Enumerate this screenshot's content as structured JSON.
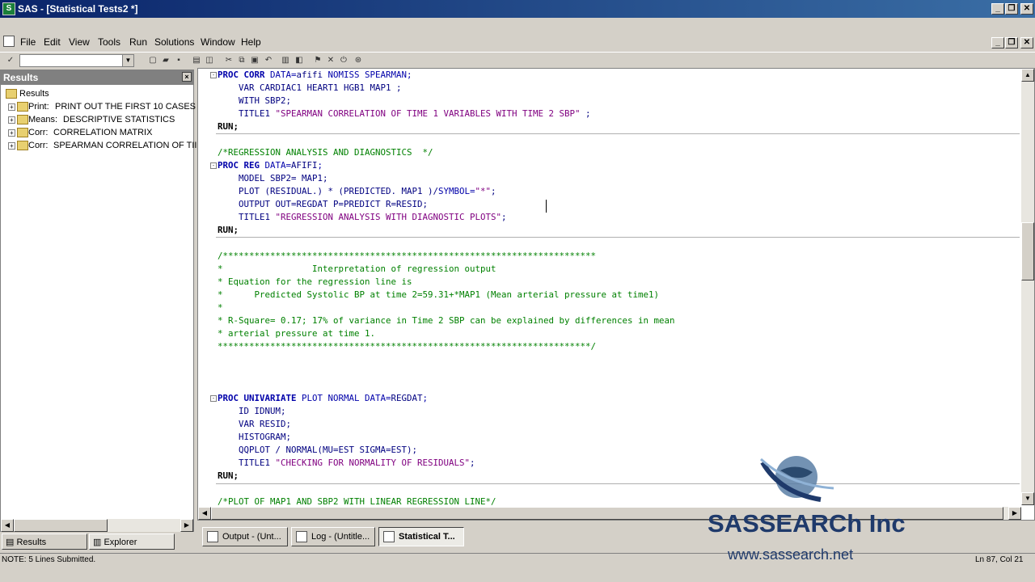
{
  "window": {
    "title": "SAS - [Statistical Tests2 *]",
    "minimize": "_",
    "restore": "❐",
    "close": "✕"
  },
  "menu": {
    "items": [
      "File",
      "Edit",
      "View",
      "Tools",
      "Run",
      "Solutions",
      "Window",
      "Help"
    ]
  },
  "toolbar": {
    "command_value": "",
    "check_glyph": "✓"
  },
  "results": {
    "title": "Results",
    "close": "×",
    "root": "Results",
    "items": [
      {
        "prefix": "Print:",
        "label": "PRINT OUT THE FIRST 10 CASES"
      },
      {
        "prefix": "Means:",
        "label": "DESCRIPTIVE STATISTICS"
      },
      {
        "prefix": "Corr:",
        "label": "CORRELATION MATRIX"
      },
      {
        "prefix": "Corr:",
        "label": "SPEARMAN CORRELATION OF TII"
      }
    ]
  },
  "left_tabs": {
    "results": "Results",
    "explorer": "Explorer"
  },
  "code": {
    "l1a": "PROC CORR",
    "l1b": " DATA=",
    "l1c": "afifi",
    "l1d": " NOMISS SPEARMAN;",
    "l2": "    VAR CARDIAC1 HEART1 HGB1 MAP1 ;",
    "l3": "    WITH SBP2;",
    "l4a": "    TITLE1 ",
    "l4b": "\"SPEARMAN CORRELATION OF TIME 1 VARIABLES WITH TIME 2 SBP\"",
    "l4c": " ;",
    "l5": "RUN;",
    "l6": "/*REGRESSION ANALYSIS AND DIAGNOSTICS  */",
    "l7a": "PROC REG",
    "l7b": " DATA=",
    "l7c": "AFIFI",
    "l7d": ";",
    "l8": "    MODEL SBP2= MAP1;",
    "l9a": "    PLOT (RESIDUAL.) * (PREDICTED. MAP1 )/",
    "l9b": "SYMBOL=",
    "l9c": "\"*\"",
    "l9d": ";",
    "l10a": "    OUTPUT OUT=REGDAT P=PREDICT R=RESID;",
    "l11a": "    TITLE1 ",
    "l11b": "\"REGRESSION ANALYSIS WITH DIAGNOSTIC PLOTS\"",
    "l11c": ";",
    "l12": "RUN;",
    "c1": "/***********************************************************************",
    "c2": "*                 Interpretation of regression output",
    "c3": "* Equation for the regression line is",
    "c4": "*      Predicted Systolic BP at time 2=59.31+*MAP1 (Mean arterial pressure at time1)",
    "c5": "*",
    "c6": "* R-Square= 0.17; 17% of variance in Time 2 SBP can be explained by differences in mean",
    "c7": "* arterial pressure at time 1.",
    "c8": "***********************************************************************/",
    "u1a": "PROC UNIVARIATE",
    "u1b": " PLOT NORMAL DATA=",
    "u1c": "REGDAT",
    "u1d": ";",
    "u2": "    ID IDNUM;",
    "u3": "    VAR RESID;",
    "u4": "    HISTOGRAM;",
    "u5": "    QQPLOT / NORMAL(MU=EST SIGMA=EST);",
    "u6a": "    TITLE1 ",
    "u6b": "\"CHECKING FOR NORMALITY OF RESIDUALS\"",
    "u6c": ";",
    "u7": "RUN;",
    "p1": "/*PLOT OF MAP1 AND SBP2 WITH LINEAR REGRESSION LINE*/"
  },
  "window_tabs": [
    {
      "label": "Output - (Unt..."
    },
    {
      "label": "Log - (Untitle..."
    },
    {
      "label": "Statistical T..."
    }
  ],
  "status": {
    "note": "NOTE: 5 Lines Submitted.",
    "position": "Ln 87, Col 21"
  },
  "logo": {
    "name": "SASSEARCh Inc",
    "url": "www.sassearch.net"
  }
}
